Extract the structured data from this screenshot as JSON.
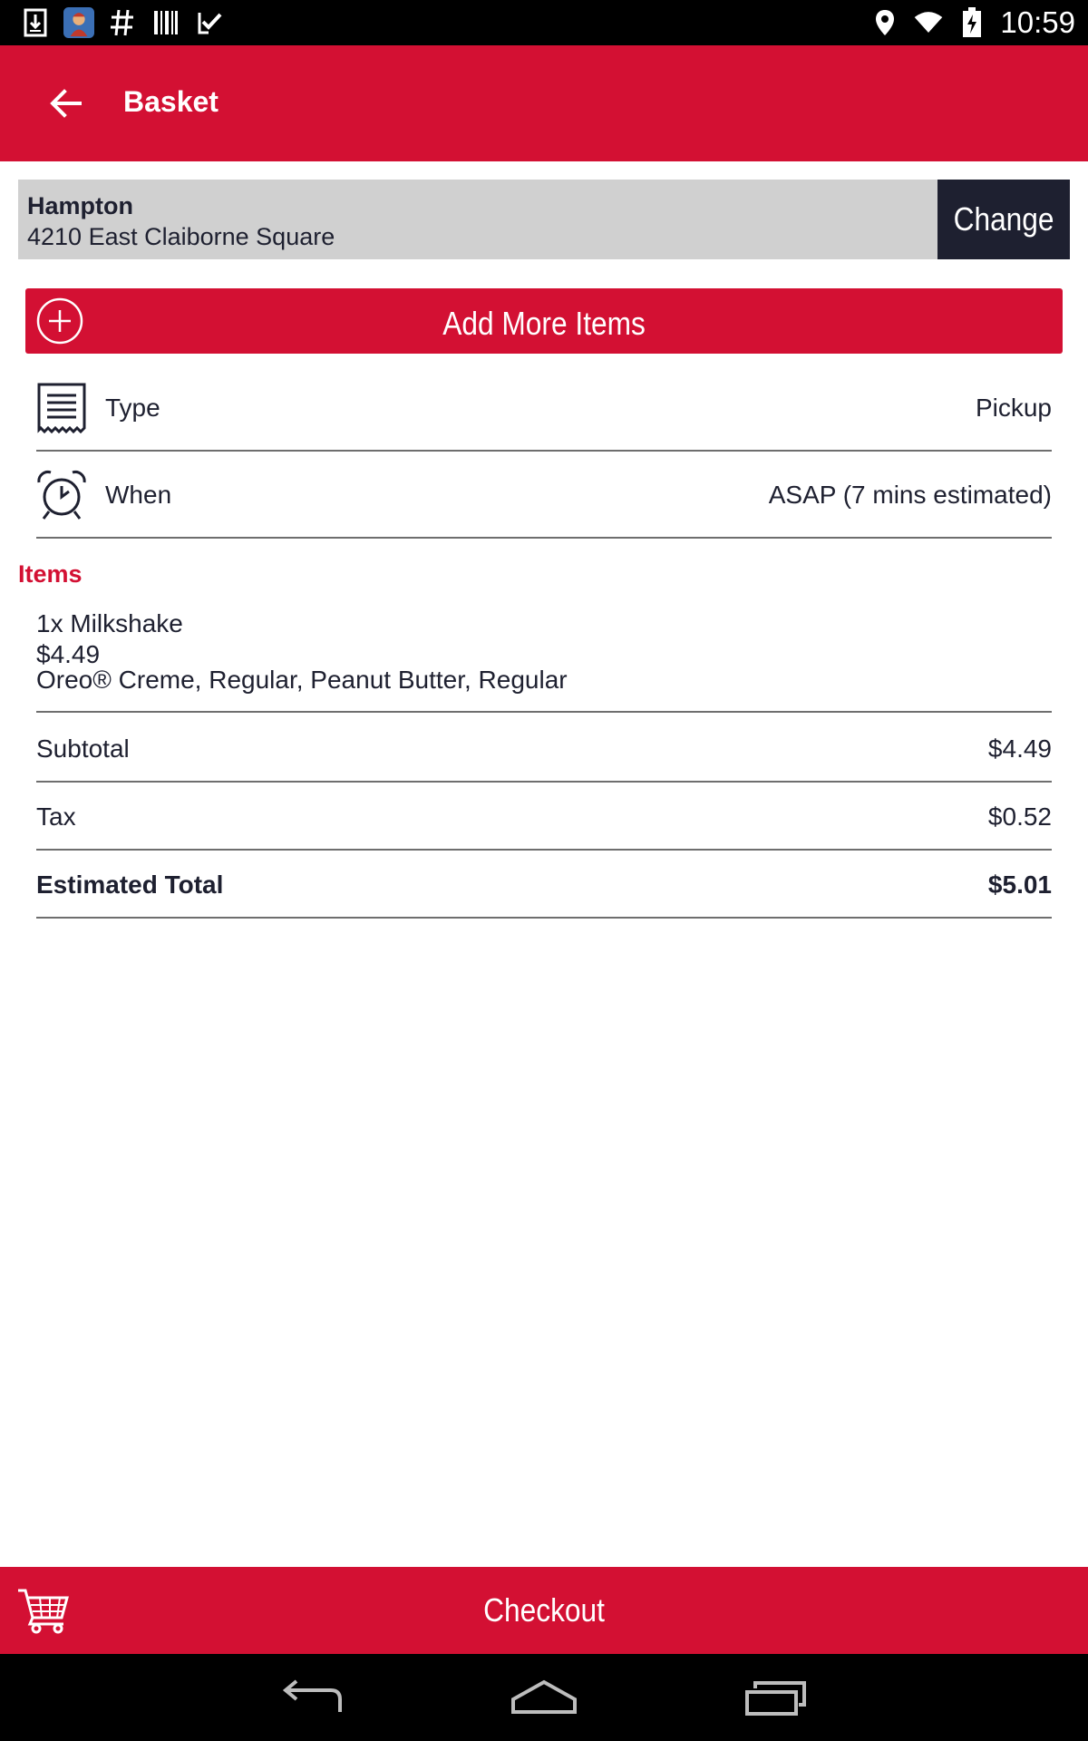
{
  "status_bar": {
    "time": "10:59",
    "left_icons": [
      "download-icon",
      "app-avatar-icon",
      "hashtag-icon",
      "barcode-icon",
      "check-list-icon"
    ],
    "right_icons": [
      "location-icon",
      "wifi-icon",
      "battery-charging-icon"
    ]
  },
  "app_bar": {
    "title": "Basket",
    "back_icon": "arrow-left-icon"
  },
  "store": {
    "name": "Hampton",
    "address": "4210 East Claiborne Square",
    "change_label": "Change"
  },
  "add_more": {
    "label": "Add More Items",
    "icon": "plus-circle-icon"
  },
  "options": [
    {
      "label": "Type",
      "value": "Pickup",
      "icon": "receipt-icon"
    },
    {
      "label": "When",
      "value": "ASAP (7 mins estimated)",
      "icon": "alarm-clock-icon"
    }
  ],
  "items_heading": "Items",
  "items": [
    {
      "title": "1x Milkshake",
      "price": "$4.49",
      "options": "Oreo® Creme, Regular, Peanut Butter, Regular"
    }
  ],
  "summary": {
    "subtotal_label": "Subtotal",
    "subtotal_value": "$4.49",
    "tax_label": "Tax",
    "tax_value": "$0.52",
    "total_label": "Estimated Total",
    "total_value": "$5.01"
  },
  "checkout": {
    "label": "Checkout",
    "icon": "cart-icon"
  },
  "nav_bar": {
    "buttons": [
      "back-nav-icon",
      "home-nav-icon",
      "recents-nav-icon"
    ]
  },
  "colors": {
    "brand_red": "#d31033",
    "dark": "#1e2030",
    "store_bar_bg": "#d0d0d0",
    "divider": "#6e6e6e"
  }
}
